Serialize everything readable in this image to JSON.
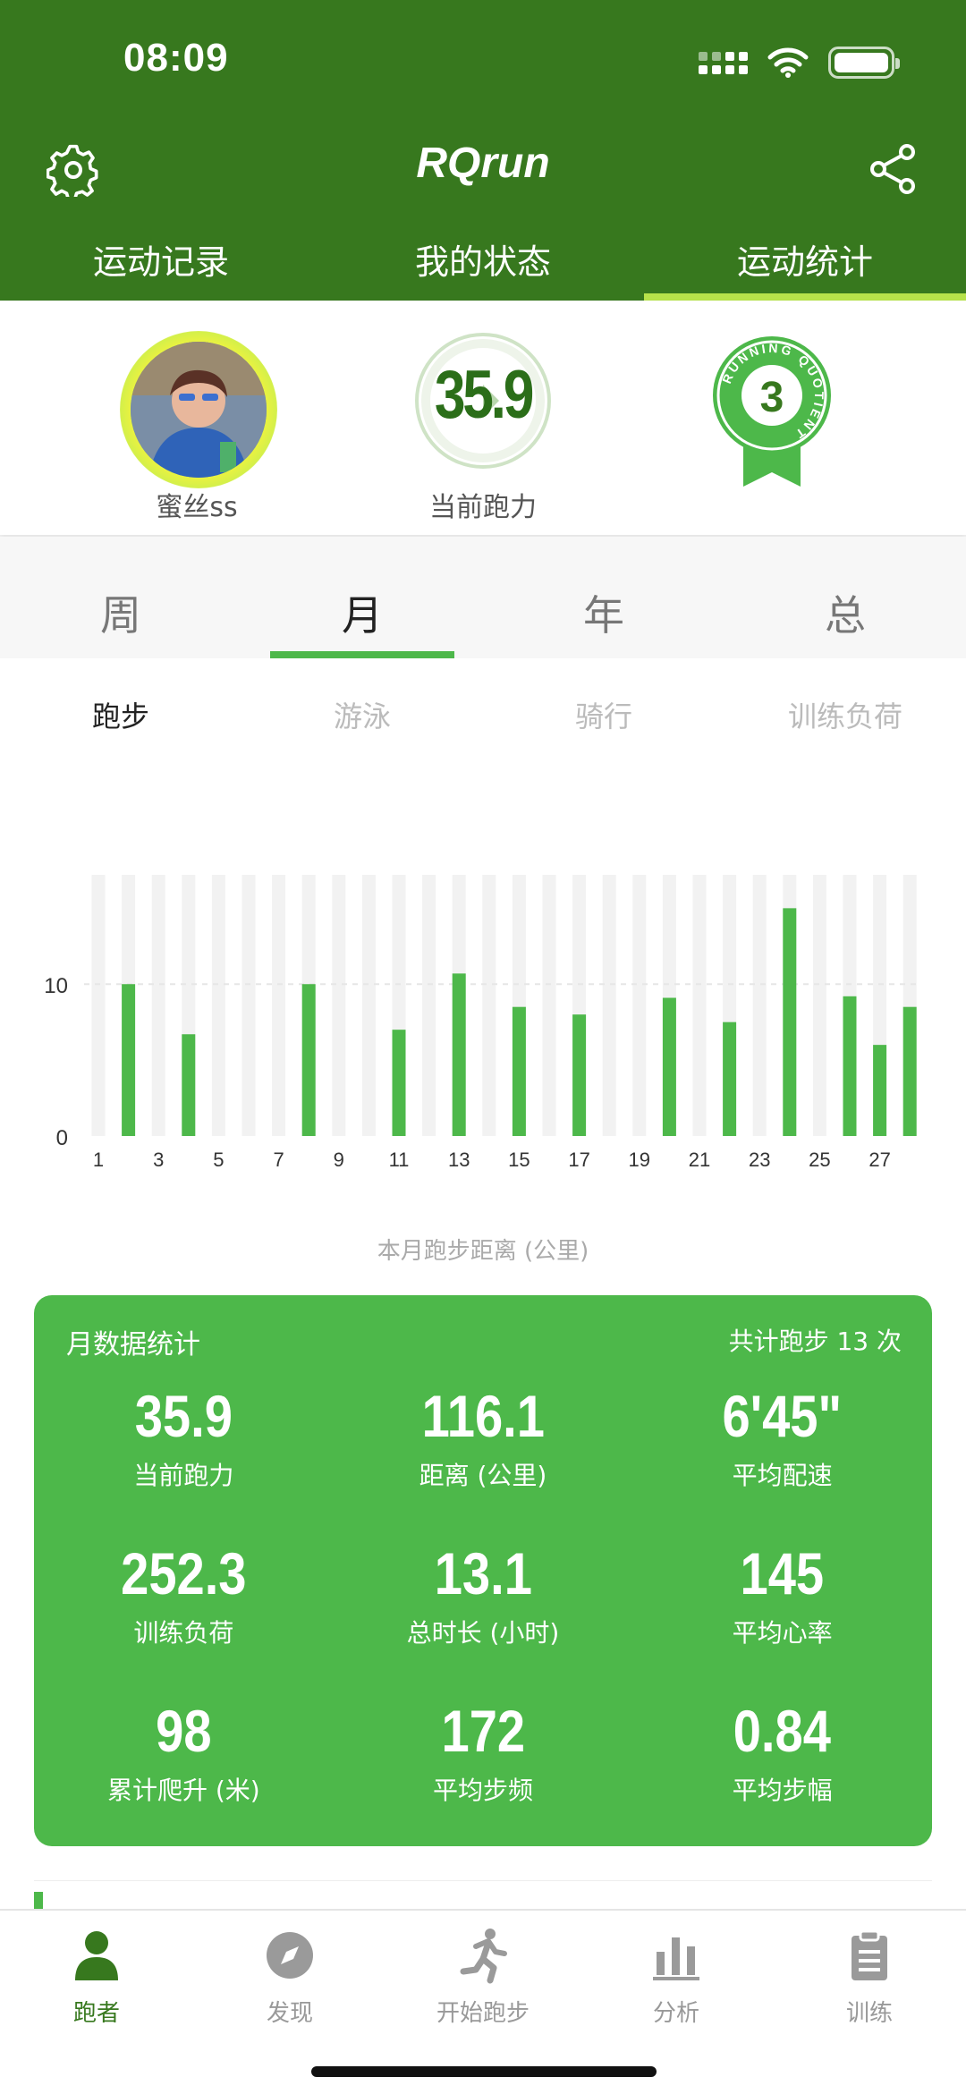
{
  "status_bar": {
    "time": "08:09"
  },
  "header": {
    "title": "RQrun",
    "tabs": [
      {
        "label": "运动记录",
        "active": false
      },
      {
        "label": "我的状态",
        "active": false
      },
      {
        "label": "运动统计",
        "active": true
      }
    ]
  },
  "profile": {
    "username": "蜜丝ss",
    "running_power": "35.9",
    "running_power_label": "当前跑力",
    "rq_level": "3",
    "rq_badge_text": "RUNNING QUOTIENT"
  },
  "period_tabs": [
    "周",
    "月",
    "年",
    "总"
  ],
  "period_active": "月",
  "sport_tabs": [
    "跑步",
    "游泳",
    "骑行",
    "训练负荷"
  ],
  "sport_active": "跑步",
  "chart_data": {
    "type": "bar",
    "caption": "本月跑步距离 (公里)",
    "x": [
      1,
      2,
      3,
      4,
      5,
      6,
      7,
      8,
      9,
      10,
      11,
      12,
      13,
      14,
      15,
      16,
      17,
      18,
      19,
      20,
      21,
      22,
      23,
      24,
      25,
      26,
      27,
      28
    ],
    "values": [
      0,
      10,
      0,
      6.7,
      0,
      0,
      0,
      10,
      0,
      0,
      7.0,
      0,
      10.7,
      0,
      8.5,
      0,
      8.0,
      0,
      0,
      9.1,
      0,
      7.5,
      0,
      15.0,
      0,
      9.2,
      6.0,
      8.5
    ],
    "xticks": [
      1,
      3,
      5,
      7,
      9,
      11,
      13,
      15,
      17,
      19,
      21,
      23,
      25,
      27
    ],
    "yticks": [
      0,
      10
    ],
    "ylim": [
      0,
      17.2
    ],
    "grid": true,
    "bar_color": "#4db84a",
    "track_color": "#f2f2f2"
  },
  "stats": {
    "title": "月数据统计",
    "count_label": "共计跑步 13 次",
    "items": [
      {
        "value": "35.9",
        "label": "当前跑力"
      },
      {
        "value": "116.1",
        "label": "距离 (公里)"
      },
      {
        "value": "6'45\"",
        "label": "平均配速"
      },
      {
        "value": "252.3",
        "label": "训练负荷"
      },
      {
        "value": "13.1",
        "label": "总时长 (小时)"
      },
      {
        "value": "145",
        "label": "平均心率"
      },
      {
        "value": "98",
        "label": "累计爬升 (米)"
      },
      {
        "value": "172",
        "label": "平均步频"
      },
      {
        "value": "0.84",
        "label": "平均步幅"
      }
    ]
  },
  "bottom_nav": [
    {
      "label": "跑者",
      "icon": "person-icon",
      "active": true
    },
    {
      "label": "发现",
      "icon": "compass-icon",
      "active": false
    },
    {
      "label": "开始跑步",
      "icon": "runner-icon",
      "active": false
    },
    {
      "label": "分析",
      "icon": "bar-chart-icon",
      "active": false
    },
    {
      "label": "训练",
      "icon": "clipboard-icon",
      "active": false
    }
  ],
  "colors": {
    "header_green": "#37781e",
    "accent_green": "#4db84a",
    "tab_indicator": "#b6e24a"
  }
}
